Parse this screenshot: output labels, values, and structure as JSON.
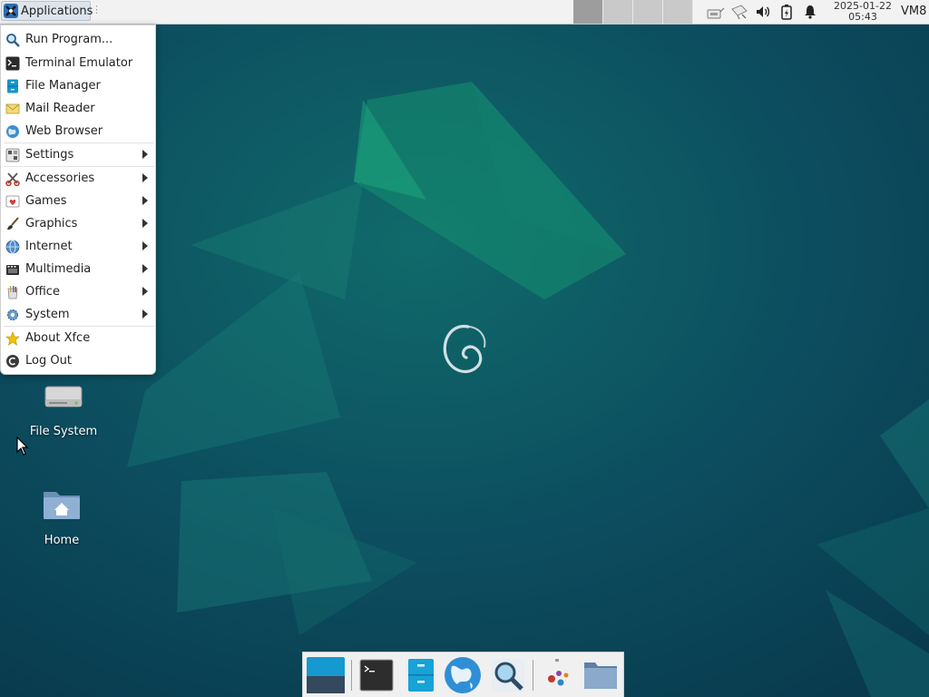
{
  "panel": {
    "applications_label": "Applications",
    "handle_glyph": "⋮",
    "workspaces": [
      {
        "name": "workspace-1",
        "active": true
      },
      {
        "name": "workspace-2",
        "active": false
      },
      {
        "name": "workspace-3",
        "active": false
      },
      {
        "name": "workspace-4",
        "active": false
      }
    ],
    "tray": [
      {
        "name": "network-wired-icon"
      },
      {
        "name": "network-disconnected-icon"
      },
      {
        "name": "volume-icon"
      },
      {
        "name": "battery-icon"
      },
      {
        "name": "notification-bell-icon"
      }
    ],
    "clock": {
      "date": "2025-01-22",
      "time": "05:43"
    },
    "hostname": "VM8"
  },
  "menu": {
    "items": [
      {
        "label": "Run Program...",
        "icon": "run-program-icon",
        "submenu": false
      },
      {
        "label": "Terminal Emulator",
        "icon": "terminal-icon",
        "submenu": false
      },
      {
        "label": "File Manager",
        "icon": "file-manager-icon",
        "submenu": false
      },
      {
        "label": "Mail Reader",
        "icon": "mail-icon",
        "submenu": false
      },
      {
        "label": "Web Browser",
        "icon": "web-browser-icon",
        "submenu": false
      },
      {
        "label": "Settings",
        "icon": "settings-icon",
        "submenu": true
      },
      {
        "label": "Accessories",
        "icon": "accessories-icon",
        "submenu": true
      },
      {
        "label": "Games",
        "icon": "games-icon",
        "submenu": true
      },
      {
        "label": "Graphics",
        "icon": "graphics-icon",
        "submenu": true
      },
      {
        "label": "Internet",
        "icon": "internet-icon",
        "submenu": true
      },
      {
        "label": "Multimedia",
        "icon": "multimedia-icon",
        "submenu": true
      },
      {
        "label": "Office",
        "icon": "office-icon",
        "submenu": true
      },
      {
        "label": "System",
        "icon": "system-icon",
        "submenu": true
      },
      {
        "label": "About Xfce",
        "icon": "star-icon",
        "submenu": false
      },
      {
        "label": "Log Out",
        "icon": "log-out-icon",
        "submenu": false
      }
    ]
  },
  "desktop": {
    "icons": [
      {
        "label": "File System",
        "icon": "drive-icon"
      },
      {
        "label": "Home",
        "icon": "home-folder-icon"
      }
    ]
  },
  "dock": {
    "items": [
      {
        "name": "show-desktop-icon"
      },
      {
        "name": "terminal-icon"
      },
      {
        "name": "file-manager-icon"
      },
      {
        "name": "web-browser-icon"
      },
      {
        "name": "app-finder-icon"
      },
      {
        "name": "settings-manager-icon"
      },
      {
        "name": "folder-icon"
      }
    ]
  },
  "colors": {
    "wallpaper_dark": "#0b3f52",
    "wallpaper_mid": "#0f5a64",
    "accent_green": "#1fa07a",
    "menu_bg": "#ffffff"
  }
}
